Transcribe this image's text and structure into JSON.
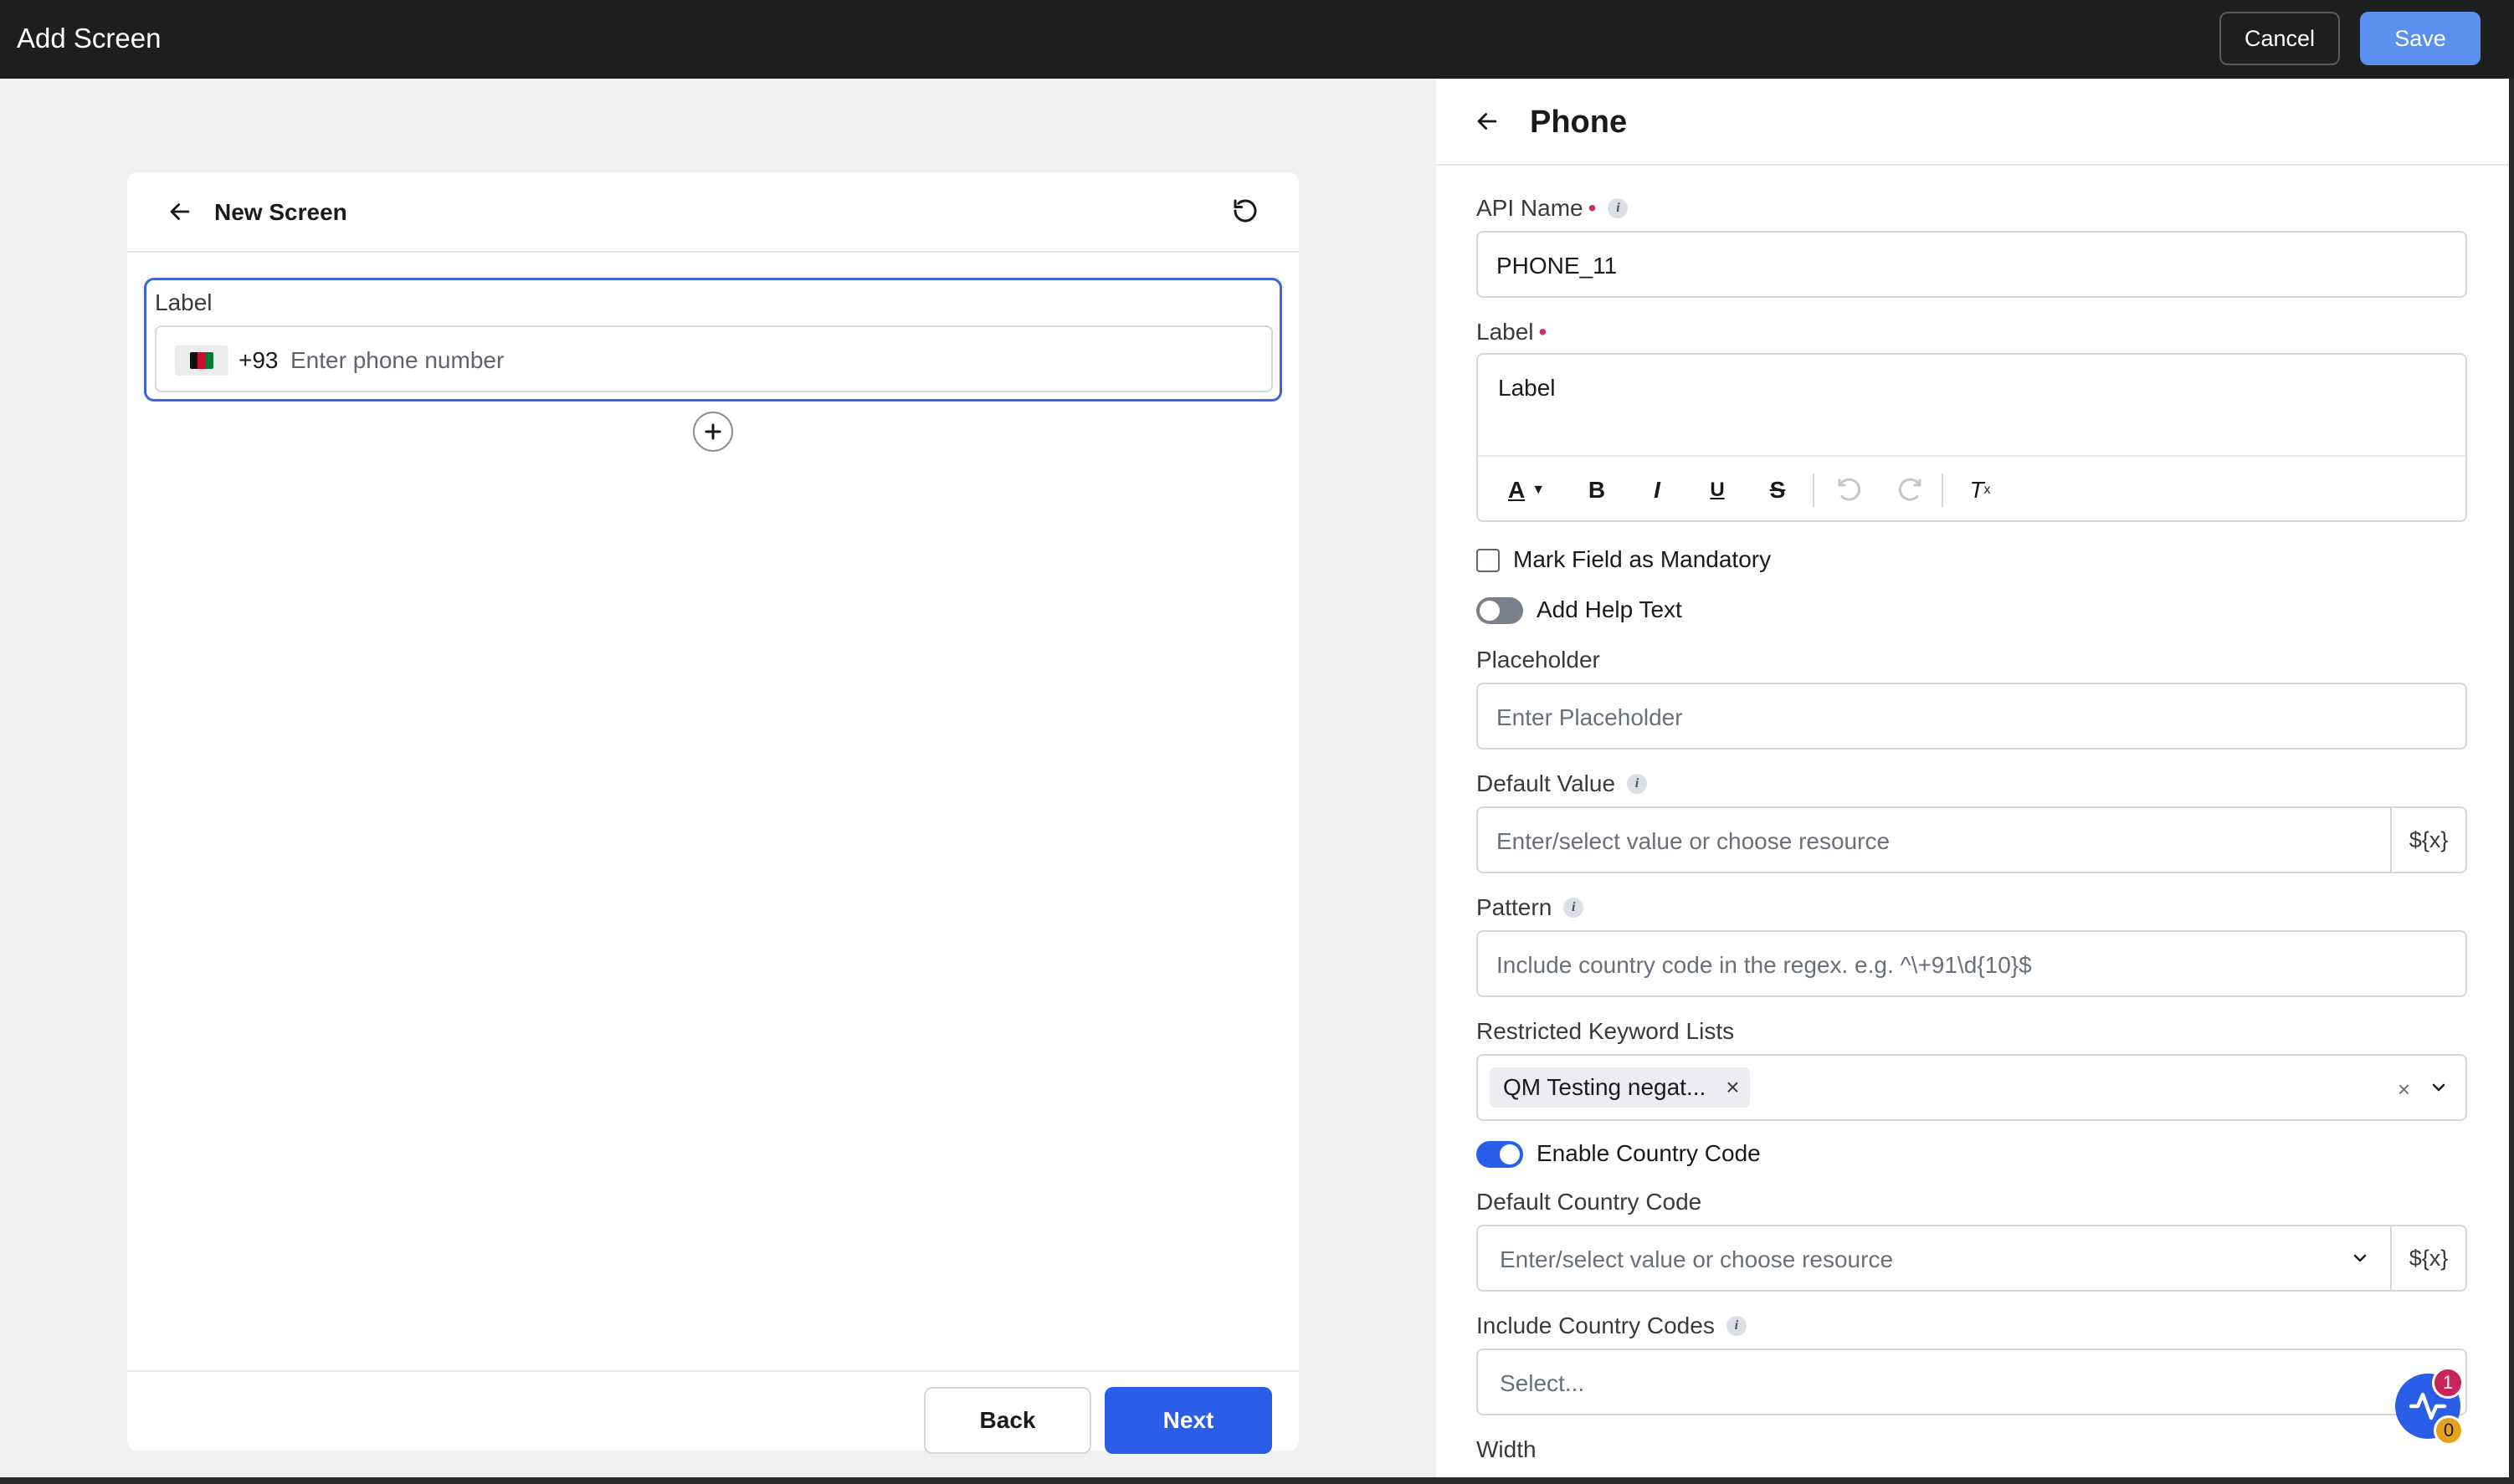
{
  "header": {
    "title": "Add Screen",
    "cancel_label": "Cancel",
    "save_label": "Save"
  },
  "preview": {
    "title": "New Screen",
    "field_label": "Label",
    "dial_code": "+93",
    "phone_placeholder": "Enter phone number",
    "back_label": "Back",
    "next_label": "Next"
  },
  "panel": {
    "title": "Phone",
    "api_name": {
      "label": "API Name",
      "value": "PHONE_11"
    },
    "label_field": {
      "label": "Label",
      "value": "Label"
    },
    "mandatory_label": "Mark Field as Mandatory",
    "help_text_label": "Add Help Text",
    "placeholder": {
      "label": "Placeholder",
      "placeholder": "Enter Placeholder"
    },
    "default_value": {
      "label": "Default Value",
      "placeholder": "Enter/select value or choose resource",
      "suffix": "${x}"
    },
    "pattern": {
      "label": "Pattern",
      "placeholder": "Include country code in the regex. e.g. ^\\+91\\d{10}$"
    },
    "restricted_keywords": {
      "label": "Restricted Keyword Lists",
      "chip": "QM Testing negat..."
    },
    "enable_country_code_label": "Enable Country Code",
    "default_country_code": {
      "label": "Default Country Code",
      "placeholder": "Enter/select value or choose resource",
      "suffix": "${x}"
    },
    "include_country_codes": {
      "label": "Include Country Codes",
      "placeholder": "Select..."
    },
    "width_label": "Width"
  },
  "badges": {
    "red_count": "1",
    "gold_count": "0"
  },
  "colors": {
    "primary": "#2a5ee8",
    "save": "#5b8ff0",
    "required": "#d12f5a",
    "topbar": "#1e1e1e"
  },
  "icons": [
    "arrow-left-icon",
    "reset-icon",
    "plus-icon",
    "info-icon",
    "text-color-icon",
    "bold-icon",
    "italic-icon",
    "underline-icon",
    "strikethrough-icon",
    "undo-icon",
    "redo-icon",
    "clear-format-icon",
    "close-icon",
    "chevron-down-icon",
    "activity-icon"
  ]
}
